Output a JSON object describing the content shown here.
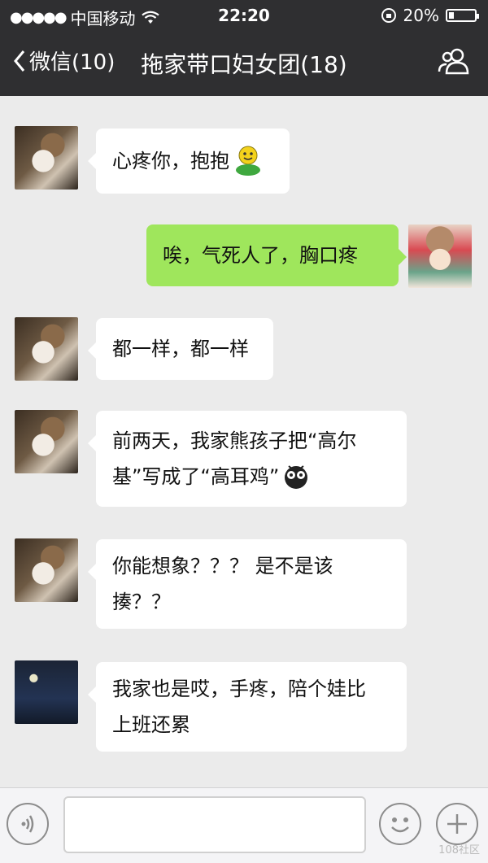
{
  "status": {
    "carrier": "中国移动",
    "time": "22:20",
    "battery": "20%",
    "battery_level": 0.2
  },
  "nav": {
    "back_label": "微信(10)",
    "title": "拖家带口妇女团(18)"
  },
  "messages": [
    {
      "side": "left",
      "avatar": "cat-avatar",
      "text": "心疼你，抱抱"
    },
    {
      "side": "right",
      "avatar": "anime-avatar",
      "text": "唉，气死人了，胸口疼"
    },
    {
      "side": "left",
      "avatar": "cat-avatar",
      "text": "都一样，都一样"
    },
    {
      "side": "left",
      "avatar": "cat-avatar",
      "line1": "前两天，我家熊孩子把“高尔",
      "line2": "基”写成了“高耳鸡”"
    },
    {
      "side": "left",
      "avatar": "cat-avatar",
      "line1": "你能想象？？？ 是不是该",
      "line2": "揍？？"
    },
    {
      "side": "left",
      "avatar": "night-avatar",
      "line1": "我家也是哎，手疼，陪个娃比",
      "line2": "上班还累"
    }
  ],
  "watermark": "108社区"
}
